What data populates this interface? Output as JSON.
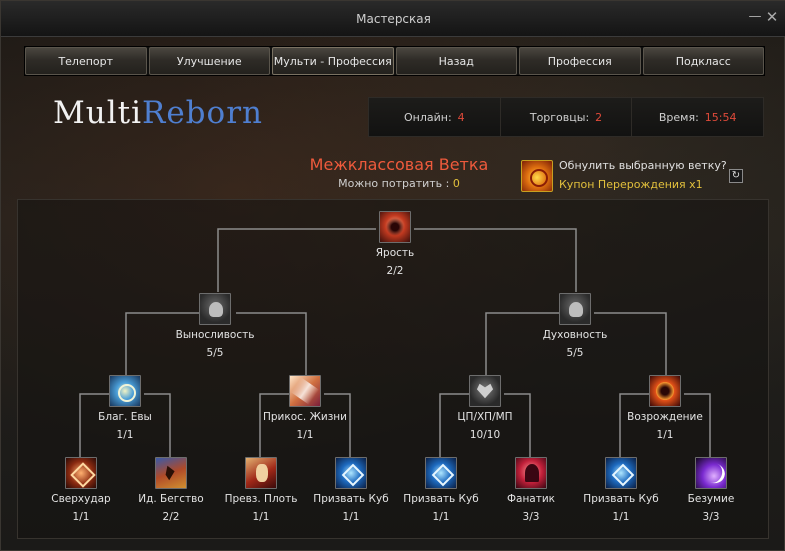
{
  "window": {
    "title": "Мастерская",
    "minimize_glyph": "—",
    "close_glyph": "✕"
  },
  "nav": [
    "Телепорт",
    "Улучшение",
    "Мульти - Профессия",
    "Назад",
    "Профессия",
    "Подкласс"
  ],
  "logo": {
    "part1": "Multi",
    "part2": "Reborn"
  },
  "stats": [
    {
      "label": "Онлайн:",
      "value": "4"
    },
    {
      "label": "Торговцы:",
      "value": "2"
    },
    {
      "label": "Время:",
      "value": "15:54"
    }
  ],
  "branch": {
    "title": "Межклассовая Ветка",
    "spend_label": "Можно потратить :",
    "spend_value": "0"
  },
  "reset": {
    "question": "Обнулить выбранную ветку?",
    "coupon": "Купон Перерождения x1",
    "refresh_icon": "refresh-icon"
  },
  "colors": {
    "accent_red": "#ee5a3c",
    "value_yellow": "#e2c03c",
    "logo_blue": "#4f7fd0"
  },
  "tree": {
    "root": {
      "name": "Ярость",
      "level": "2/2",
      "icon": "rage-icon"
    },
    "tier2": [
      {
        "name": "Выносливость",
        "level": "5/5",
        "icon": "endurance-icon"
      },
      {
        "name": "Духовность",
        "level": "5/5",
        "icon": "spirit-icon"
      }
    ],
    "tier3": [
      {
        "name": "Благ. Евы",
        "level": "1/1",
        "icon": "eva-blessing-icon"
      },
      {
        "name": "Прикос. Жизни",
        "level": "1/1",
        "icon": "touch-of-life-icon"
      },
      {
        "name": "ЦП/ХП/МП",
        "level": "10/10",
        "icon": "cp-hp-mp-icon"
      },
      {
        "name": "Возрождение",
        "level": "1/1",
        "icon": "rebirth-icon"
      }
    ],
    "tier4": [
      {
        "name": "Сверхудар",
        "level": "1/1",
        "icon": "critical-strike-icon"
      },
      {
        "name": "Ид. Бегство",
        "level": "2/2",
        "icon": "escape-icon"
      },
      {
        "name": "Превз. Плоть",
        "level": "1/1",
        "icon": "flesh-icon"
      },
      {
        "name": "Призвать Куб",
        "level": "1/1",
        "icon": "cube-icon"
      },
      {
        "name": "Призвать Куб",
        "level": "1/1",
        "icon": "cube-icon"
      },
      {
        "name": "Фанатик",
        "level": "3/3",
        "icon": "fanatic-icon"
      },
      {
        "name": "Призвать Куб",
        "level": "1/1",
        "icon": "cube-icon"
      },
      {
        "name": "Безумие",
        "level": "3/3",
        "icon": "madness-icon"
      }
    ]
  }
}
